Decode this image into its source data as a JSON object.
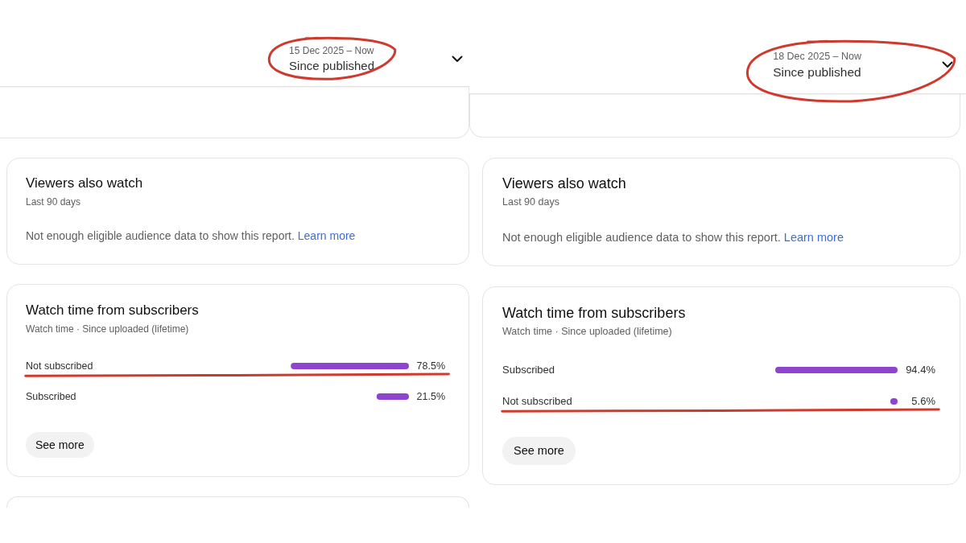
{
  "panels": [
    {
      "date_picker": {
        "range": "15 Dec 2025 – Now",
        "period": "Since published",
        "circled": true
      },
      "cards": [
        {
          "kind": "card_bottom"
        },
        {
          "kind": "message",
          "title": "Viewers also watch",
          "subtitle": "Last 90 days",
          "message": "Not enough eligible audience data to show this report.",
          "link": "Learn more"
        },
        {
          "kind": "bars",
          "title": "Watch time from subscribers",
          "subtitle": "Watch time · Since uploaded (lifetime)",
          "chart_data": {
            "type": "bar",
            "orientation": "horizontal",
            "categories": [
              "Not subscribed",
              "Subscribed"
            ],
            "values": [
              78.5,
              21.5
            ],
            "value_labels": [
              "78.5%",
              "21.5%"
            ]
          },
          "underlined": [
            true,
            false
          ],
          "button": "See more"
        },
        {
          "kind": "card_top"
        }
      ]
    },
    {
      "date_picker": {
        "range": "18 Dec 2025 – Now",
        "period": "Since published",
        "circled": true
      },
      "cards": [
        {
          "kind": "card_bottom"
        },
        {
          "kind": "message",
          "title": "Viewers also watch",
          "subtitle": "Last 90 days",
          "message": "Not enough eligible audience data to show this report.",
          "link": "Learn more"
        },
        {
          "kind": "bars",
          "title": "Watch time from subscribers",
          "subtitle": "Watch time · Since uploaded (lifetime)",
          "chart_data": {
            "type": "bar",
            "orientation": "horizontal",
            "categories": [
              "Subscribed",
              "Not subscribed"
            ],
            "values": [
              94.4,
              5.6
            ],
            "value_labels": [
              "94.4%",
              "5.6%"
            ]
          },
          "underlined": [
            false,
            true
          ],
          "button": "See more"
        }
      ]
    }
  ]
}
